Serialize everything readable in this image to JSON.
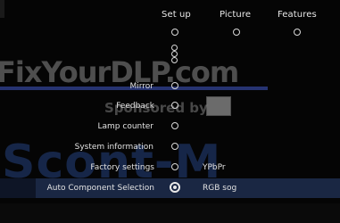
{
  "tabs": [
    {
      "label": "Set up"
    },
    {
      "label": "Picture"
    },
    {
      "label": "Features"
    }
  ],
  "menu": {
    "items": [
      {
        "label": "Mirror"
      },
      {
        "label": "Feedback"
      },
      {
        "label": "Lamp counter"
      },
      {
        "label": "System information"
      },
      {
        "label": "Factory settings",
        "value": "YPbPr"
      },
      {
        "label": "Auto Component Selection",
        "value": "RGB sog",
        "selected": true
      }
    ]
  },
  "watermark": {
    "site": "FixYourDLP.com",
    "sponsor": "Sponsored by",
    "overlay": "Scont-M"
  },
  "colors": {
    "background": "#050505",
    "text": "#e2e2e2",
    "selection": "#1d2b4a"
  }
}
